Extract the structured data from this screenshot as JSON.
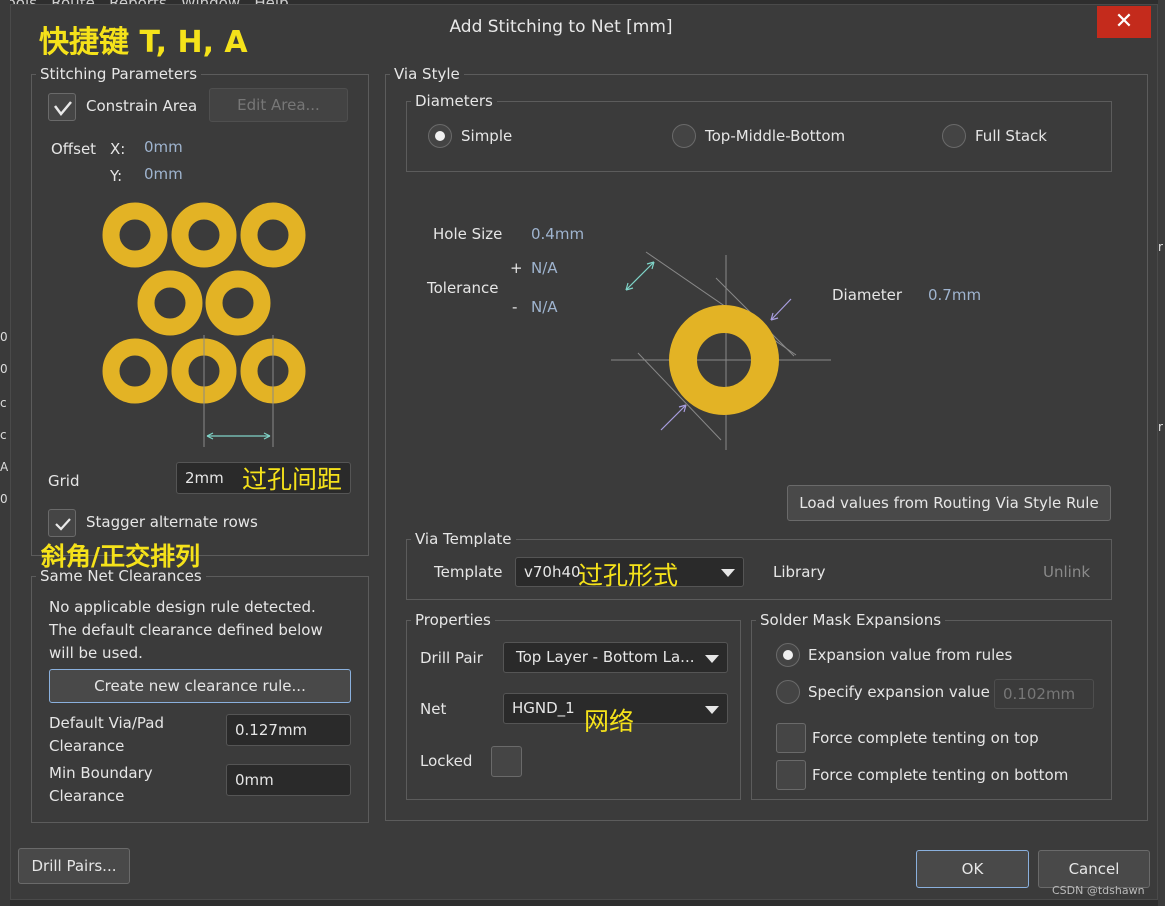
{
  "background": {
    "menu_text": "Tools   Route   Reports   Window   Help",
    "left_chars": [
      "0",
      "0",
      "c",
      "c",
      "A",
      "0"
    ],
    "right_chars": [
      "r",
      "r"
    ]
  },
  "dialog": {
    "title": "Add Stitching to Net [mm]",
    "close_glyph": "✕"
  },
  "annotations": {
    "shortcut": "快捷键  T, H, A",
    "via_spacing": "过孔间距",
    "stagger_note": "斜角/正交排列",
    "via_form": "过孔形式",
    "net_note": "网络"
  },
  "stitching": {
    "group_label": "Stitching Parameters",
    "constrain_area_label": "Constrain Area",
    "constrain_area_checked": true,
    "edit_area_label": "Edit Area...",
    "offset_label": "Offset",
    "x_label": "X:",
    "x_value": "0mm",
    "y_label": "Y:",
    "y_value": "0mm",
    "grid_label": "Grid",
    "grid_value": "2mm",
    "stagger_label": "Stagger alternate rows",
    "stagger_checked": true
  },
  "clearances": {
    "group_label": "Same Net Clearances",
    "msg_line1": "No applicable design rule detected.",
    "msg_line2": "The default clearance defined below",
    "msg_line3": "will be used.",
    "create_rule_label": "Create new clearance rule...",
    "default_label_1": "Default Via/Pad",
    "default_label_2": "Clearance",
    "default_value": "0.127mm",
    "min_label_1": "Min Boundary",
    "min_label_2": "Clearance",
    "min_value": "0mm"
  },
  "via_style": {
    "group_label": "Via Style",
    "diameters_label": "Diameters",
    "options": [
      {
        "label": "Simple",
        "selected": true
      },
      {
        "label": "Top-Middle-Bottom",
        "selected": false
      },
      {
        "label": "Full Stack",
        "selected": false
      }
    ],
    "hole_size_label": "Hole Size",
    "hole_size_value": "0.4mm",
    "tolerance_label": "Tolerance",
    "plus_sign": "+",
    "minus_sign": "-",
    "tol_plus": "N/A",
    "tol_minus": "N/A",
    "diameter_label": "Diameter",
    "diameter_value": "0.7mm",
    "load_rule_label": "Load values from Routing Via Style Rule",
    "pad_color": "#e3b325"
  },
  "template": {
    "group_label": "Via Template",
    "template_label": "Template",
    "template_value": "v70h40",
    "library_label": "Library",
    "unlink_label": "Unlink"
  },
  "properties": {
    "group_label": "Properties",
    "drill_pair_label": "Drill Pair",
    "drill_pair_value": "Top Layer - Bottom La...",
    "net_label": "Net",
    "net_value": "HGND_1",
    "locked_label": "Locked",
    "locked_checked": false
  },
  "solder_mask": {
    "group_label": "Solder Mask Expansions",
    "from_rules_label": "Expansion value from rules",
    "from_rules_selected": true,
    "specify_label": "Specify expansion value",
    "specify_value": "0.102mm",
    "tent_top_label": "Force complete tenting on top",
    "tent_bottom_label": "Force complete tenting on bottom"
  },
  "footer": {
    "drill_pairs_label": "Drill Pairs...",
    "ok_label": "OK",
    "cancel_label": "Cancel",
    "watermark": "CSDN @tdshawn"
  }
}
